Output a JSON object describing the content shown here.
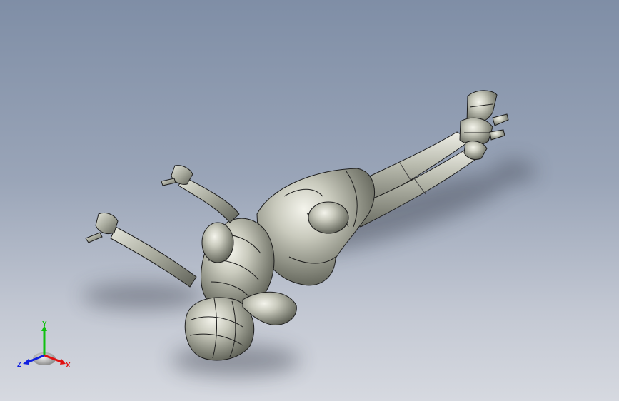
{
  "viewport": {
    "background_top": "#7f8ea6",
    "background_bottom": "#d6d9e0",
    "model_color": "#b4b6a8",
    "edge_color": "#1e1e1e"
  },
  "triad": {
    "x_label": "X",
    "y_label": "Y",
    "z_label": "Z",
    "x_color": "#e01010",
    "y_color": "#10c010",
    "z_color": "#1020e0"
  }
}
